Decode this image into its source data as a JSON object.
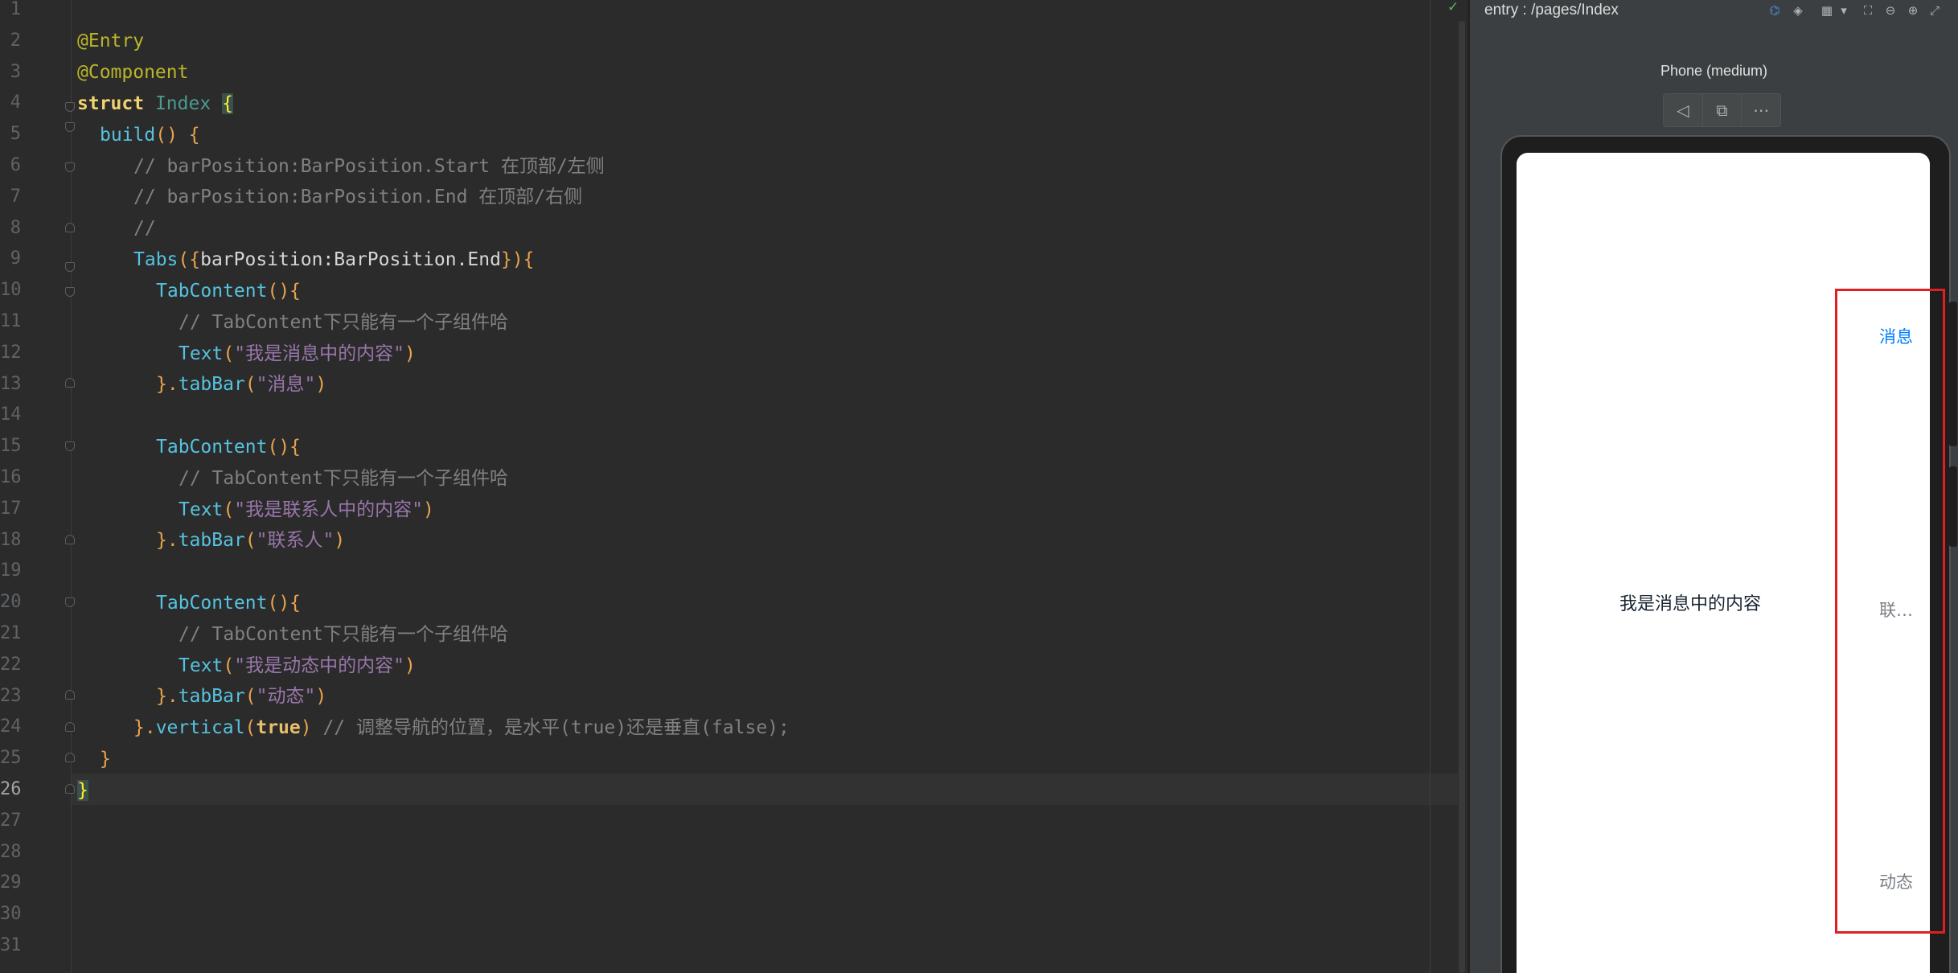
{
  "editor": {
    "line_numbers": [
      "1",
      "2",
      "3",
      "4",
      "5",
      "6",
      "7",
      "8",
      "9",
      "10",
      "11",
      "12",
      "13",
      "14",
      "15",
      "16",
      "17",
      "18",
      "19",
      "20",
      "21",
      "22",
      "23",
      "24",
      "25",
      "26",
      "27",
      "28",
      "29",
      "30",
      "31"
    ],
    "code": {
      "l2": "@Entry",
      "l3": "@Component",
      "l4_kw": "struct",
      "l4_name": "Index",
      "l4_brace": "{",
      "l5_fn": "build",
      "l5_rest": "() {",
      "l6": "// barPosition:BarPosition.Start 在顶部/左侧",
      "l7": "// barPosition:BarPosition.End 在顶部/右侧",
      "l8": "//",
      "l9_fn": "Tabs",
      "l9_open": "({",
      "l9_arg": "barPosition:BarPosition.End",
      "l9_close": "}){",
      "tc_fn": "TabContent",
      "tc_rest": "(){",
      "tc_comment": "// TabContent下只能有一个子组件哈",
      "text_fn": "Text",
      "l12_str": "\"我是消息中的内容\"",
      "l17_str": "\"我是联系人中的内容\"",
      "l22_str": "\"我是动态中的内容\"",
      "tabbar_close": "}.",
      "tabbar_fn": "tabBar",
      "l13_str": "\"消息\"",
      "l18_str": "\"联系人\"",
      "l23_str": "\"动态\"",
      "l24_close": "}.",
      "l24_fn": "vertical",
      "l24_val": "true",
      "l24_comment": "// 调整导航的位置，是水平(true)还是垂直(false);",
      "close_brace": "}",
      "paren_open": "(",
      "paren_close": ")"
    }
  },
  "previewer": {
    "path": "entry : /pages/Index",
    "device_name": "Phone (medium)",
    "toolbar_icons": [
      "inspector-icon",
      "layers-icon",
      "grid-icon",
      "dropdown-icon",
      "fit-icon",
      "zoom-out-icon",
      "zoom-in-icon",
      "fullscreen-icon"
    ],
    "content_text": "我是消息中的内容",
    "tabs": [
      {
        "label": "消息",
        "active": true
      },
      {
        "label": "联…",
        "active": false
      },
      {
        "label": "动态",
        "active": false
      }
    ],
    "colors": {
      "active_tab": "#007dff",
      "inactive_tab": "#7a7f86",
      "highlight": "#e02020"
    }
  }
}
